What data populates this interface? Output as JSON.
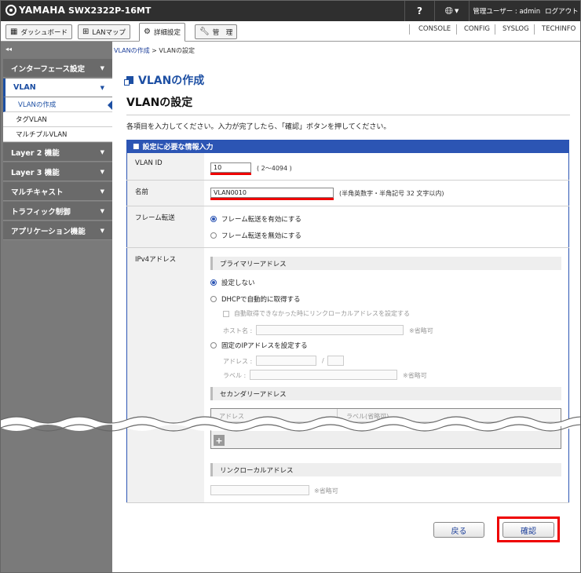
{
  "header": {
    "brand": "YAMAHA",
    "model": "SWX2322P-16MT",
    "help": "?",
    "user": "管理ユーザー : admin",
    "logout": "ログアウト"
  },
  "nav": {
    "tabs": [
      {
        "label": "ダッシュボード",
        "icon": "dashboard-icon"
      },
      {
        "label": "LANマップ",
        "icon": "lan-map-icon"
      },
      {
        "label": "詳細設定",
        "icon": "gear-icon"
      },
      {
        "label": "管　理",
        "icon": "wrench-icon"
      }
    ],
    "links": [
      "CONSOLE",
      "CONFIG",
      "SYSLOG",
      "TECHINFO"
    ]
  },
  "sidebar": {
    "collapse": "◂◂",
    "items": [
      {
        "label": "インターフェース設定"
      },
      {
        "label": "VLAN"
      },
      {
        "label": "Layer 2 機能"
      },
      {
        "label": "Layer 3 機能"
      },
      {
        "label": "マルチキャスト"
      },
      {
        "label": "トラフィック制御"
      },
      {
        "label": "アプリケーション機能"
      }
    ],
    "vlan_sub": [
      {
        "label": "VLANの作成"
      },
      {
        "label": "タグVLAN"
      },
      {
        "label": "マルチプルVLAN"
      }
    ]
  },
  "breadcrumb": {
    "link": "VLANの作成",
    "sep": ">",
    "current": "VLANの設定"
  },
  "page": {
    "title": "VLANの作成",
    "subtitle": "VLANの設定",
    "instruction": "各項目を入力してください。入力が完了したら、「確認」ボタンを押してください。"
  },
  "form": {
    "section_title": "設定に必要な情報入力",
    "vlan_id": {
      "label": "VLAN ID",
      "value": "10",
      "hint": "( 2〜4094 )"
    },
    "name": {
      "label": "名前",
      "value": "VLAN0010",
      "hint": "(半角英数字・半角記号 32 文字以内)"
    },
    "frame": {
      "label": "フレーム転送",
      "options": [
        "フレーム転送を有効にする",
        "フレーム転送を無効にする"
      ]
    },
    "ipv4": {
      "label": "IPv4アドレス",
      "primary_title": "プライマリーアドレス",
      "options": [
        "設定しない",
        "DHCPで自動的に取得する",
        "固定のIPアドレスを設定する"
      ],
      "fallback_label": "自動取得できなかった時にリンクローカルアドレスを設定する",
      "host_label": "ホスト名 :",
      "optional": "※省略可",
      "address_label": "アドレス :",
      "slash": "/",
      "addr_label2": "ラベル :",
      "secondary_title": "セカンダリーアドレス",
      "col_address": "アドレス",
      "col_label": "ラベル(省略可)",
      "add": "+",
      "linklocal_title": "リンクローカルアドレス"
    }
  },
  "buttons": {
    "back": "戻る",
    "confirm": "確認"
  },
  "colors": {
    "accent": "#2c55b4",
    "highlight": "#e00000",
    "sidebar": "#6a6a6a"
  }
}
